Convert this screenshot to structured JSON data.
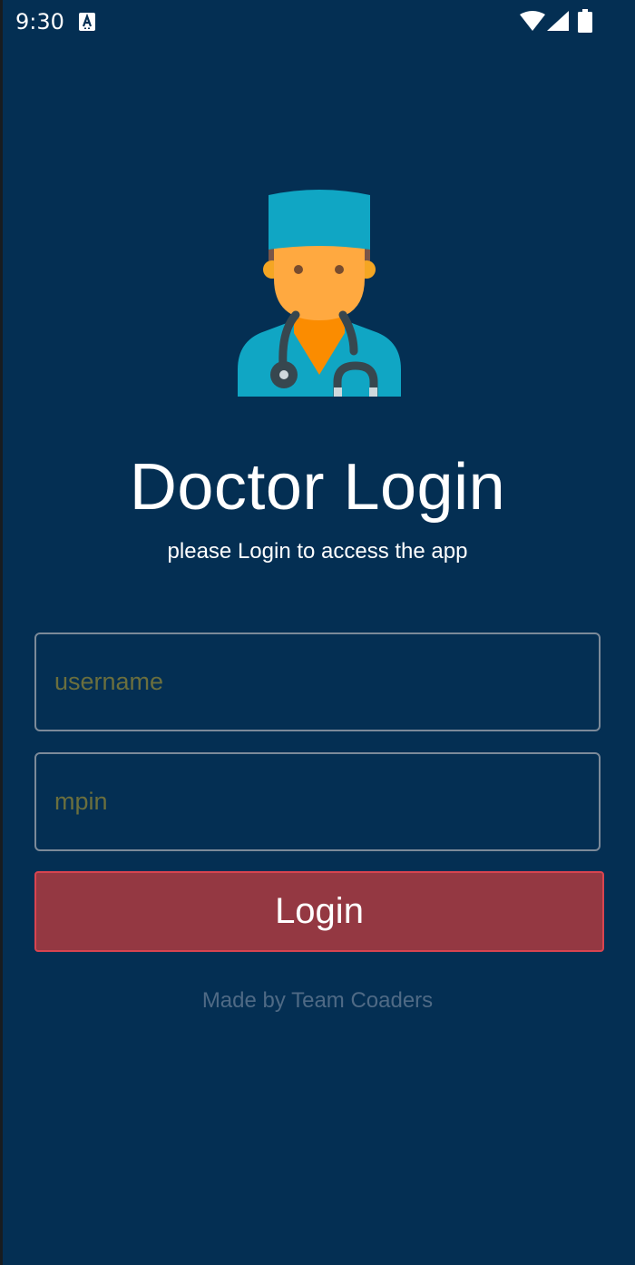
{
  "status_bar": {
    "time": "9:30",
    "icons": [
      "accessibility-icon",
      "wifi-icon",
      "signal-icon",
      "battery-icon"
    ]
  },
  "header": {
    "avatar_icon": "doctor-icon",
    "title": "Doctor Login",
    "subtitle": "please Login to access the app"
  },
  "form": {
    "username": {
      "value": "",
      "placeholder": "username"
    },
    "mpin": {
      "value": "",
      "placeholder": "mpin"
    },
    "login_label": "Login"
  },
  "footer": {
    "credit": "Made by Team Coaders"
  },
  "colors": {
    "background": "#042f53",
    "button": "#943842",
    "button_border": "#d84450",
    "placeholder": "#6b6f3e",
    "field_border": "#7c8a99",
    "footer_text": "#4f6a85"
  }
}
